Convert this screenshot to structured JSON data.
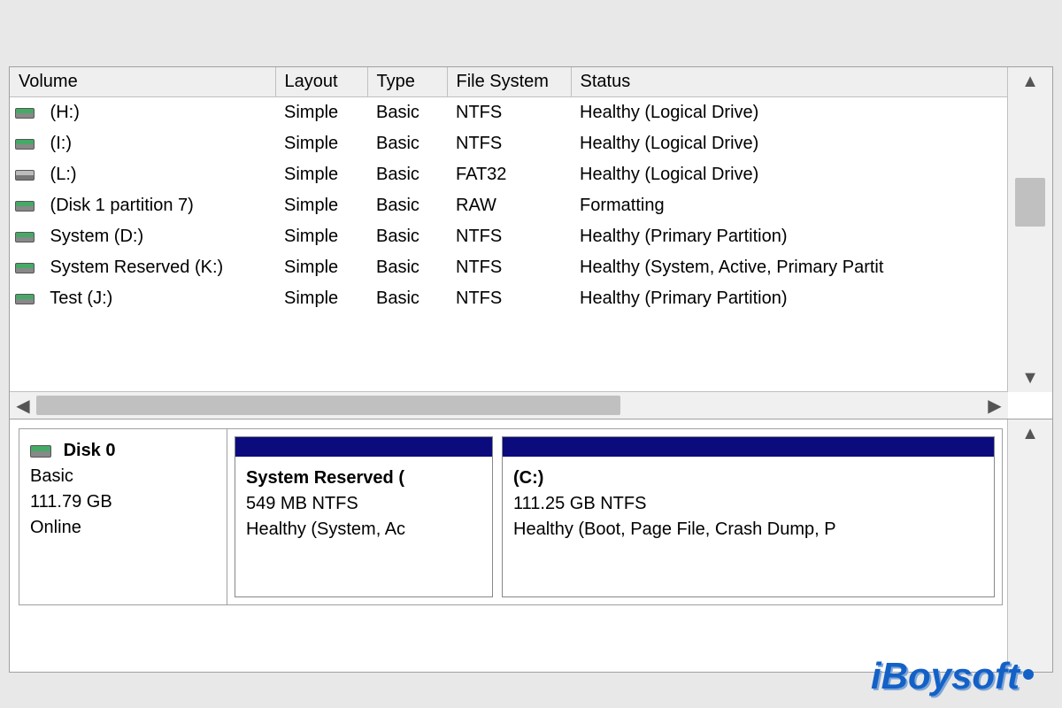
{
  "columns": {
    "volume": "Volume",
    "layout": "Layout",
    "type": "Type",
    "fs": "File System",
    "status": "Status"
  },
  "volumes": [
    {
      "icon": "green",
      "name": " (H:)",
      "layout": "Simple",
      "type": "Basic",
      "fs": "NTFS",
      "status": "Healthy (Logical Drive)"
    },
    {
      "icon": "green",
      "name": " (I:)",
      "layout": "Simple",
      "type": "Basic",
      "fs": "NTFS",
      "status": "Healthy (Logical Drive)"
    },
    {
      "icon": "gray",
      "name": " (L:)",
      "layout": "Simple",
      "type": "Basic",
      "fs": "FAT32",
      "status": "Healthy (Logical Drive)"
    },
    {
      "icon": "green",
      "name": " (Disk 1 partition 7)",
      "layout": "Simple",
      "type": "Basic",
      "fs": "RAW",
      "status": "Formatting"
    },
    {
      "icon": "green",
      "name": " System (D:)",
      "layout": "Simple",
      "type": "Basic",
      "fs": "NTFS",
      "status": "Healthy (Primary Partition)"
    },
    {
      "icon": "green",
      "name": " System Reserved (K:)",
      "layout": "Simple",
      "type": "Basic",
      "fs": "NTFS",
      "status": "Healthy (System, Active, Primary Partit"
    },
    {
      "icon": "green",
      "name": " Test (J:)",
      "layout": "Simple",
      "type": "Basic",
      "fs": "NTFS",
      "status": "Healthy (Primary Partition)"
    }
  ],
  "disk0": {
    "title": "Disk 0",
    "type": "Basic",
    "size": "111.79 GB",
    "state": "Online",
    "partitions": [
      {
        "name": "System Reserved  (",
        "info": "549 MB NTFS",
        "status": "Healthy (System, Ac",
        "flex": "0 0 290px"
      },
      {
        "name": "  (C:)",
        "info": "111.25 GB NTFS",
        "status": "Healthy (Boot, Page File, Crash Dump, P",
        "flex": "1"
      }
    ]
  },
  "watermark": "iBoysoft"
}
